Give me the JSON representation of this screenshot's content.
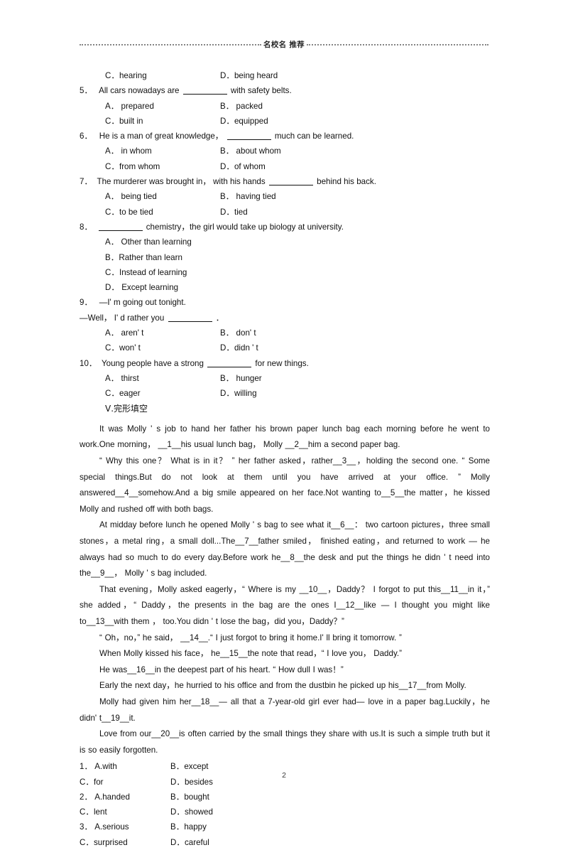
{
  "header": {
    "title": "名校名 推荐"
  },
  "multiple_choice": {
    "carryover_options": {
      "left": "C．hearing",
      "right": "D．being heard"
    },
    "questions": [
      {
        "number": "5．",
        "stem_before": "All cars nowadays are",
        "stem_after": "with safety belts.",
        "options": [
          {
            "left": "A．  prepared",
            "right": "B．  packed"
          },
          {
            "left": "C．built in",
            "right": "D．equipped"
          }
        ]
      },
      {
        "number": "6．",
        "stem_before": "He is a man of great knowledge，",
        "stem_after": "much can be learned.",
        "options": [
          {
            "left": "A．  in whom",
            "right": "B．  about whom"
          },
          {
            "left": "C．from whom",
            "right": "D．of whom"
          }
        ]
      },
      {
        "number": "7．",
        "stem_before": "The murderer was brought in，  with his hands",
        "stem_after": "behind his back.",
        "options": [
          {
            "left": "A．  being tied",
            "right": "B．  having tied"
          },
          {
            "left": "C．to be tied",
            "right": "D．tied"
          }
        ]
      },
      {
        "number": "8．",
        "stem_before": "",
        "stem_after": "chemistry，the girl would take up biology at university.",
        "options_single": [
          "A．  Other than learning",
          "B．Rather than learn",
          "C．Instead of learning",
          "D．  Except learning"
        ]
      },
      {
        "number": "9．",
        "stem_line1": "—I'  m going out tonight.",
        "stem_line2_before": "—Well，  I'  d rather you",
        "stem_line2_after": "．",
        "options": [
          {
            "left": "A．  aren'  t",
            "right": "B．  don'  t"
          },
          {
            "left": "C．won'  t",
            "right": "D．didn '  t"
          }
        ]
      },
      {
        "number": "10．",
        "stem_before": "Young people have a strong",
        "stem_after": "for new things.",
        "options": [
          {
            "left": "A．  thirst",
            "right": "B．  hunger"
          },
          {
            "left": "C．eager",
            "right": "D．willing"
          }
        ]
      }
    ]
  },
  "cloze": {
    "section_title": "Ⅴ.完形填空",
    "paragraphs": [
      "It was Molly '   s job to hand her father his brown paper lunch bag each morning before he went to work.One morning， __1__his usual lunch bag， Molly __2__him a second paper bag.",
      "“ Why this one？ What is in it？ ” her father asked，rather__3__，holding   the second one. “ Some special things.But do not look at them until you have arrived at your office.    ” Molly answered__4__somehow.And a big smile appeared on her face.Not wanting to__5__the matter，he kissed Molly and rushed off with both bags.",
      "At midday before lunch he opened Molly '   s bag to see what it__6__： two cartoon pictures，three small stones，a metal ring，a small doll...The__7__father smiled， finished eating，and returned to work — he always had so much to do every day.Before work he__8__the desk and put the things he didn '   t need into the__9__， Molly '   s bag included.",
      "That evening，Molly   asked eagerly，“ Where is my __10__，Daddy？ I forgot  to put this__11__in it，” she added，“ Daddy，the presents in the bag are the ones I__12__like  — I thought you might like to__13__with them ， too.You didn '   t lose the bag，did you，Daddy？”",
      "“ Oh，no，” he said， __14__.“ I just forgot to bring it home.I'  ll bring it tomorrow.  ”",
      "When Molly kissed his face， he__15__the note that read，“ I love you， Daddy.”",
      "He was__16__in the deepest part of his heart. “ How dull I was！”",
      "Early the next day，he hurried to his office and from  the dustbin he picked up his__17__from Molly.",
      "Molly  had given him  her__18__— all that a 7-year-old girl   ever had— love in a paper bag.Luckily，he didn'  t__19__it.",
      "Love from our__20__is often carried by the small things they share with us.It is such a simple truth but it is so easily forgotten."
    ],
    "answer_options": [
      {
        "number": "1．",
        "a": "A.with",
        "b": "B．except",
        "c": "C．for",
        "d": "D．besides"
      },
      {
        "number": "2．",
        "a": "A.handed",
        "b": "B．bought",
        "c": "C．lent",
        "d": "D．showed"
      },
      {
        "number": "3．",
        "a": "A.serious",
        "b": "B．happy",
        "c": "C．surprised",
        "d": "D．careful"
      }
    ]
  },
  "footer": {
    "page_number": "2"
  }
}
